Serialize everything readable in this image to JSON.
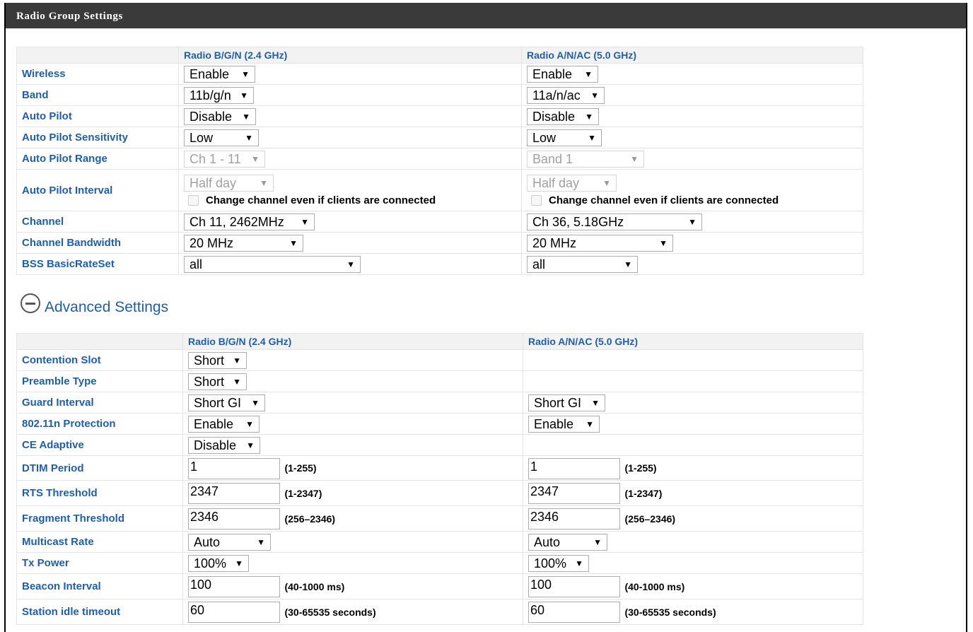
{
  "title": "Radio Group Settings",
  "radio_group": {
    "col_24": "Radio B/G/N (2.4 GHz)",
    "col_5": "Radio A/N/AC (5.0 GHz)",
    "rows": {
      "wireless": {
        "label": "Wireless",
        "v24": "Enable",
        "v5": "Enable"
      },
      "band": {
        "label": "Band",
        "v24": "11b/g/n",
        "v5": "11a/n/ac"
      },
      "auto_pilot": {
        "label": "Auto Pilot",
        "v24": "Disable",
        "v5": "Disable"
      },
      "sensitivity": {
        "label": "Auto Pilot Sensitivity",
        "v24": "Low",
        "v5": "Low"
      },
      "range": {
        "label": "Auto Pilot Range",
        "v24": "Ch 1 - 11",
        "v5": "Band 1"
      },
      "interval": {
        "label": "Auto Pilot Interval",
        "v24": "Half day",
        "v5": "Half day",
        "checkbox_label": "Change channel even if clients are connected"
      },
      "channel": {
        "label": "Channel",
        "v24": "Ch 11, 2462MHz",
        "v5": "Ch 36, 5.18GHz"
      },
      "bandwidth": {
        "label": "Channel Bandwidth",
        "v24": "20 MHz",
        "v5": "20 MHz"
      },
      "bss": {
        "label": "BSS BasicRateSet",
        "v24": "all",
        "v5": "all"
      }
    }
  },
  "advanced_toggle": "Advanced Settings",
  "advanced": {
    "col_24": "Radio B/G/N (2.4 GHz)",
    "col_5": "Radio A/N/AC (5.0 GHz)",
    "rows": {
      "contention": {
        "label": "Contention Slot",
        "v24": "Short"
      },
      "preamble": {
        "label": "Preamble Type",
        "v24": "Short"
      },
      "guard": {
        "label": "Guard Interval",
        "v24": "Short GI",
        "v5": "Short GI"
      },
      "protection": {
        "label": "802.11n Protection",
        "v24": "Enable",
        "v5": "Enable"
      },
      "ce": {
        "label": "CE Adaptive",
        "v24": "Disable"
      },
      "dtim": {
        "label": "DTIM Period",
        "v24": "1",
        "v5": "1",
        "hint": "(1-255)"
      },
      "rts": {
        "label": "RTS Threshold",
        "v24": "2347",
        "v5": "2347",
        "hint": "(1-2347)"
      },
      "frag": {
        "label": "Fragment Threshold",
        "v24": "2346",
        "v5": "2346",
        "hint": "(256–2346)"
      },
      "multicast": {
        "label": "Multicast Rate",
        "v24": "Auto",
        "v5": "Auto"
      },
      "txpower": {
        "label": "Tx Power",
        "v24": "100%",
        "v5": "100%"
      },
      "beacon": {
        "label": "Beacon Interval",
        "v24": "100",
        "v5": "100",
        "hint": "(40-1000 ms)"
      },
      "idle": {
        "label": "Station idle timeout",
        "v24": "60",
        "v5": "60",
        "hint": "(30-65535 seconds)"
      }
    }
  },
  "colors": {
    "label_blue": "#1f5fa8",
    "title_bar": "#3a3a3a"
  }
}
